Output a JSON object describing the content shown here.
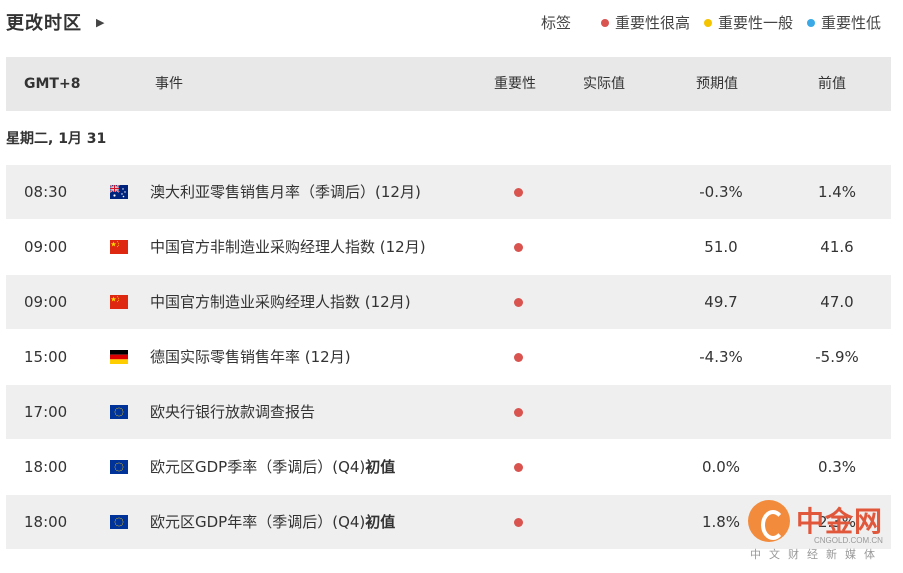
{
  "header": {
    "timezone_label": "更改时区",
    "legend_tag": "标签",
    "legend": [
      {
        "label": "重要性很高",
        "color": "#d9534f"
      },
      {
        "label": "重要性一般",
        "color": "#f5c400"
      },
      {
        "label": "重要性低",
        "color": "#3aa9e6"
      }
    ]
  },
  "table": {
    "columns": {
      "gmt": "GMT+8",
      "event": "事件",
      "importance": "重要性",
      "actual": "实际值",
      "forecast": "预期值",
      "previous": "前值"
    },
    "day_label": "星期二, 1月 31",
    "rows": [
      {
        "time": "08:30",
        "flag": "au-flag-icon",
        "event": "澳大利亚零售销售月率（季调后）(12月)",
        "event_bold": "",
        "importance": "high",
        "actual": "",
        "forecast": "-0.3%",
        "previous": "1.4%"
      },
      {
        "time": "09:00",
        "flag": "cn-flag-icon",
        "event": "中国官方非制造业采购经理人指数 (12月)",
        "event_bold": "",
        "importance": "high",
        "actual": "",
        "forecast": "51.0",
        "previous": "41.6"
      },
      {
        "time": "09:00",
        "flag": "cn-flag-icon",
        "event": "中国官方制造业采购经理人指数 (12月)",
        "event_bold": "",
        "importance": "high",
        "actual": "",
        "forecast": "49.7",
        "previous": "47.0"
      },
      {
        "time": "15:00",
        "flag": "de-flag-icon",
        "event": "德国实际零售销售年率 (12月)",
        "event_bold": "",
        "importance": "high",
        "actual": "",
        "forecast": "-4.3%",
        "previous": "-5.9%"
      },
      {
        "time": "17:00",
        "flag": "eu-flag-icon",
        "event": "欧央行银行放款调查报告",
        "event_bold": "",
        "importance": "high",
        "actual": "",
        "forecast": "",
        "previous": ""
      },
      {
        "time": "18:00",
        "flag": "eu-flag-icon",
        "event": "欧元区GDP季率（季调后）(Q4)",
        "event_bold": "初值",
        "importance": "high",
        "actual": "",
        "forecast": "0.0%",
        "previous": "0.3%"
      },
      {
        "time": "18:00",
        "flag": "eu-flag-icon",
        "event": "欧元区GDP年率（季调后）(Q4)",
        "event_bold": "初值",
        "importance": "high",
        "actual": "",
        "forecast": "1.8%",
        "previous": "2.3%"
      }
    ]
  },
  "watermark": {
    "name": "中金网",
    "url": "CNGOLD.COM.CN",
    "tagline": "中文财经新媒体"
  }
}
